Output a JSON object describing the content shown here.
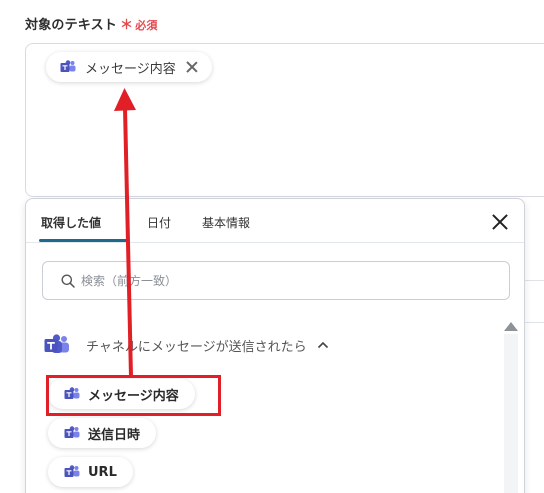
{
  "field": {
    "label": "対象のテキスト",
    "required_star": "＊",
    "required_text": "必須"
  },
  "selected_chip": {
    "label": "メッセージ内容",
    "icon": "teams-icon"
  },
  "panel": {
    "tabs": [
      {
        "label": "取得した値",
        "active": true
      },
      {
        "label": "日付",
        "active": false
      },
      {
        "label": "基本情報",
        "active": false
      }
    ],
    "search": {
      "placeholder": "検索（前方一致）"
    },
    "group": {
      "label": "チャネルにメッセージが送信されたら",
      "icon": "teams-icon",
      "expanded": true
    },
    "options": [
      {
        "label": "メッセージ内容",
        "icon": "teams-icon",
        "highlighted": true
      },
      {
        "label": "送信日時",
        "icon": "teams-icon",
        "highlighted": false
      },
      {
        "label": "URL",
        "icon": "teams-icon",
        "highlighted": false
      }
    ]
  },
  "colors": {
    "required": "#e5484d",
    "tab_underline": "#1e6a8c",
    "teams_purple": "#5059c9",
    "annotation_red": "#e01f26"
  }
}
